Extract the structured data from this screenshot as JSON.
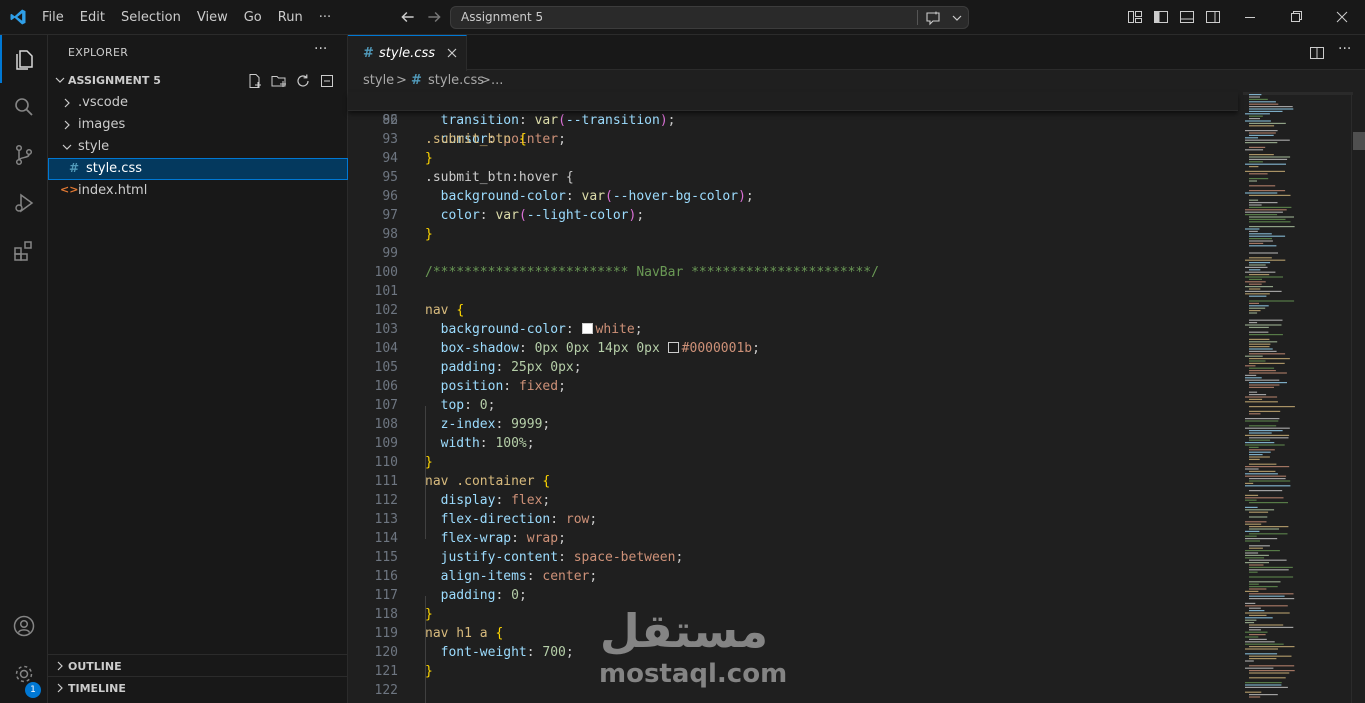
{
  "menu": [
    "File",
    "Edit",
    "Selection",
    "View",
    "Go",
    "Run",
    "···"
  ],
  "command_center": {
    "text": "Assignment 5"
  },
  "explorer": {
    "title": "EXPLORER",
    "more": "···",
    "folder": "ASSIGNMENT 5",
    "items": [
      {
        "label": ".vscode",
        "type": "folder"
      },
      {
        "label": "images",
        "type": "folder"
      },
      {
        "label": "style",
        "type": "folder-open"
      },
      {
        "label": "style.css",
        "type": "css"
      },
      {
        "label": "index.html",
        "type": "html"
      }
    ],
    "outline": "OUTLINE",
    "timeline": "TIMELINE"
  },
  "accounts_badge": "1",
  "tab": {
    "icon": "#",
    "name": "style.css"
  },
  "breadcrumb": [
    "style",
    ">",
    "#",
    "style.css",
    ">",
    "..."
  ],
  "sticky": {
    "num": "86",
    "text": ".submit_btn {"
  },
  "code_lines": [
    {
      "n": "92",
      "t": "  transition: var(--transition);"
    },
    {
      "n": "93",
      "t": "  cursor: pointer;"
    },
    {
      "n": "94",
      "t": "}"
    },
    {
      "n": "95",
      "t": ".submit_btn:hover {"
    },
    {
      "n": "96",
      "t": "  background-color: var(--hover-bg-color);"
    },
    {
      "n": "97",
      "t": "  color: var(--light-color);"
    },
    {
      "n": "98",
      "t": "}"
    },
    {
      "n": "99",
      "t": ""
    },
    {
      "n": "100",
      "t": "/************************* NavBar ***********************/"
    },
    {
      "n": "101",
      "t": ""
    },
    {
      "n": "102",
      "t": "nav {"
    },
    {
      "n": "103",
      "t": "  background-color: white;"
    },
    {
      "n": "104",
      "t": "  box-shadow: 0px 0px 14px 0px #0000001b;"
    },
    {
      "n": "105",
      "t": "  padding: 25px 0px;"
    },
    {
      "n": "106",
      "t": "  position: fixed;"
    },
    {
      "n": "107",
      "t": "  top: 0;"
    },
    {
      "n": "108",
      "t": "  z-index: 9999;"
    },
    {
      "n": "109",
      "t": "  width: 100%;"
    },
    {
      "n": "110",
      "t": "}"
    },
    {
      "n": "111",
      "t": "nav .container {"
    },
    {
      "n": "112",
      "t": "  display: flex;"
    },
    {
      "n": "113",
      "t": "  flex-direction: row;"
    },
    {
      "n": "114",
      "t": "  flex-wrap: wrap;"
    },
    {
      "n": "115",
      "t": "  justify-content: space-between;"
    },
    {
      "n": "116",
      "t": "  align-items: center;"
    },
    {
      "n": "117",
      "t": "  padding: 0;"
    },
    {
      "n": "118",
      "t": "}"
    },
    {
      "n": "119",
      "t": "nav h1 a {"
    },
    {
      "n": "120",
      "t": "  font-weight: 700;"
    },
    {
      "n": "121",
      "t": "}"
    },
    {
      "n": "122",
      "t": ""
    }
  ],
  "watermark": {
    "arabic": "مستقل",
    "latin": "mostaql.com"
  },
  "colors": {
    "accent": "#0078d4",
    "css_icon": "#519aba",
    "html_icon": "#e37933"
  }
}
